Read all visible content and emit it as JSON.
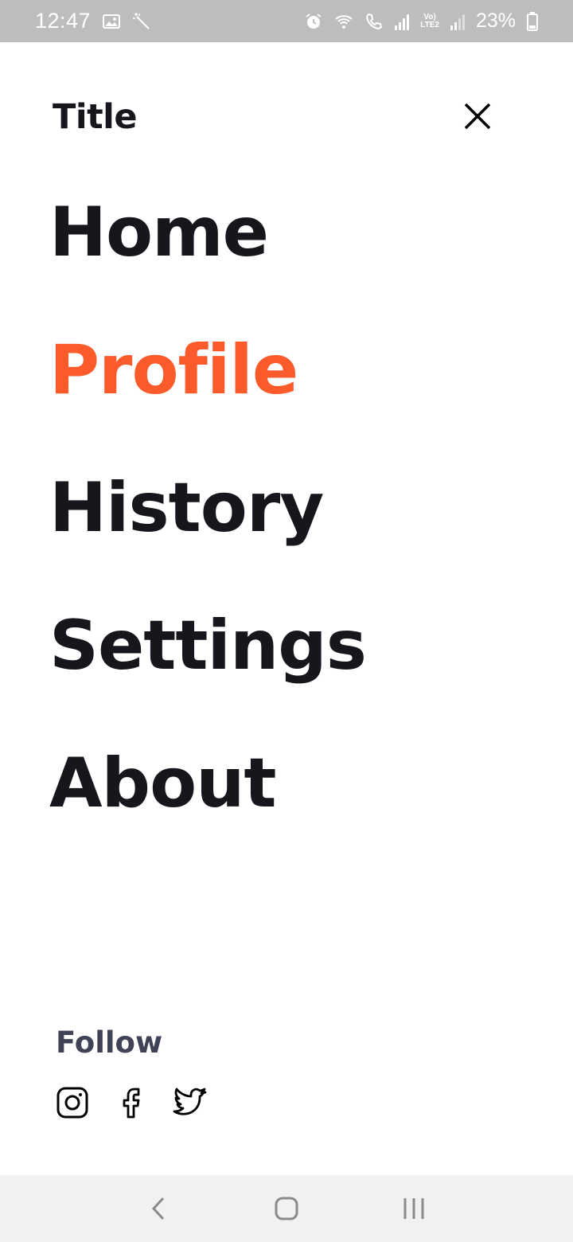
{
  "status_bar": {
    "time": "12:47",
    "battery_text": "23%",
    "network_label_top": "Vo)",
    "network_label_bottom": "LTE2",
    "icons": [
      "image-icon",
      "magic-wand-icon",
      "alarm-icon",
      "wifi-icon",
      "call-icon",
      "signal-icon",
      "battery-icon"
    ]
  },
  "menu": {
    "title": "Title",
    "close_icon": "close-icon",
    "items": [
      {
        "label": "Home",
        "active": false
      },
      {
        "label": "Profile",
        "active": true
      },
      {
        "label": "History",
        "active": false
      },
      {
        "label": "Settings",
        "active": false
      },
      {
        "label": "About",
        "active": false
      }
    ],
    "active_color": "#fb5a2b",
    "text_color": "#16171d"
  },
  "follow": {
    "label": "Follow",
    "icons": [
      "instagram-icon",
      "facebook-icon",
      "twitter-icon"
    ]
  },
  "system_nav": {
    "buttons": [
      "back-icon",
      "home-icon",
      "recents-icon"
    ]
  }
}
